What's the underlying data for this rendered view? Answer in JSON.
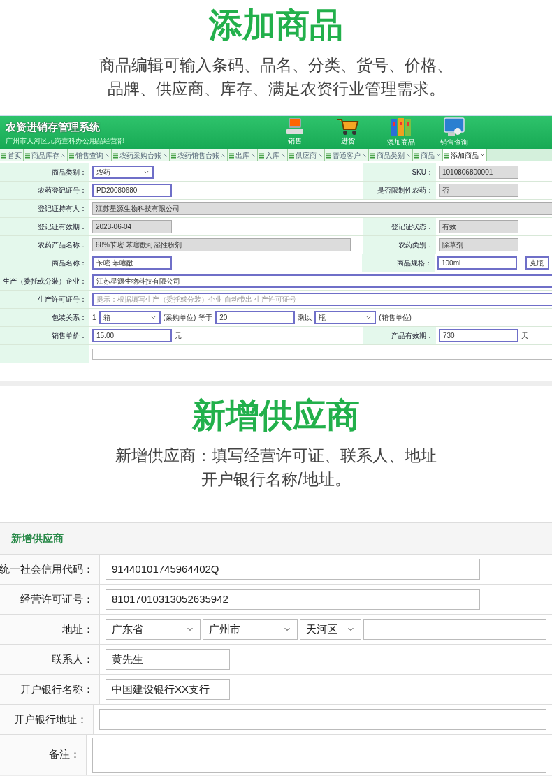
{
  "section_1": {
    "title": "添加商品",
    "description": [
      "商品编辑可输入条码、品名、分类、货号、价格、",
      "品牌、供应商、库存、满足农资行业管理需求。"
    ]
  },
  "app": {
    "title": "农资进销存管理系统",
    "subtitle": "广州市天河区元岗壹科办公用品经营部",
    "toolbar": [
      {
        "kind": "computer",
        "label": "销售"
      },
      {
        "kind": "cart",
        "label": "进货"
      },
      {
        "kind": "binders",
        "label": "添加商品"
      },
      {
        "kind": "monitor",
        "label": "销售查询"
      }
    ],
    "tabs": [
      {
        "label": "首页",
        "closable": false,
        "selected": false
      },
      {
        "label": "商品库存",
        "closable": true,
        "selected": false
      },
      {
        "label": "销售查询",
        "closable": true,
        "selected": false
      },
      {
        "label": "农药采购台账",
        "closable": true,
        "selected": false
      },
      {
        "label": "农药销售台账",
        "closable": true,
        "selected": false
      },
      {
        "label": "出库",
        "closable": true,
        "selected": false
      },
      {
        "label": "入库",
        "closable": true,
        "selected": false
      },
      {
        "label": "供应商",
        "closable": true,
        "selected": false
      },
      {
        "label": "普通客户",
        "closable": true,
        "selected": false
      },
      {
        "label": "商品类别",
        "closable": true,
        "selected": false
      },
      {
        "label": "商品",
        "closable": true,
        "selected": false
      },
      {
        "label": "添加商品",
        "closable": true,
        "selected": true
      }
    ],
    "form_rows": [
      {
        "groups": [
          {
            "label": "商品类别：",
            "fields": [
              {
                "kind": "select",
                "value": "农药"
              }
            ]
          },
          {
            "label": "SKU：",
            "fields": [
              {
                "kind": "readonly",
                "value": "1010806800001"
              }
            ]
          }
        ]
      },
      {
        "groups": [
          {
            "label": "农药登记证号：",
            "fields": [
              {
                "kind": "input",
                "value": "PD20080680"
              }
            ]
          },
          {
            "label": "是否限制性农药：",
            "fields": [
              {
                "kind": "readonly",
                "value": "否"
              }
            ]
          }
        ]
      },
      {
        "groups": [
          {
            "label": "登记证持有人：",
            "fields": [
              {
                "kind": "readonly_wide",
                "value": "江苏星源生物科技有限公司"
              }
            ]
          }
        ]
      },
      {
        "groups": [
          {
            "label": "登记证有效期：",
            "fields": [
              {
                "kind": "readonly",
                "value": "2023-06-04"
              }
            ]
          },
          {
            "label": "登记证状态：",
            "fields": [
              {
                "kind": "readonly",
                "value": "有效"
              }
            ]
          }
        ]
      },
      {
        "groups": [
          {
            "label": "农药产品名称：",
            "fields": [
              {
                "kind": "readonly_long",
                "value": "68%苄嘧 苯噻酰可湿性粉剂"
              }
            ]
          },
          {
            "label": "农药类别：",
            "fields": [
              {
                "kind": "readonly",
                "value": "除草剂"
              }
            ]
          }
        ]
      },
      {
        "groups": [
          {
            "label": "商品名称：",
            "fields": [
              {
                "kind": "input",
                "value": "苄嘧 苯噻酰"
              }
            ]
          },
          {
            "label": "商品规格：",
            "fields": [
              {
                "kind": "input",
                "value": "100ml"
              },
              {
                "kind": "input_short",
                "value": "克瓶"
              }
            ]
          }
        ]
      },
      {
        "groups": [
          {
            "label": "生产（委托或分装）企业：",
            "fields": [
              {
                "kind": "input_wide",
                "value": "江苏星源生物科技有限公司"
              }
            ]
          }
        ]
      },
      {
        "groups": [
          {
            "label": "生产许可证号：",
            "fields": [
              {
                "kind": "input_wide",
                "placeholder": "提示：根据填写生产（委托或分装）企业 自动带出 生产许可证号"
              }
            ]
          }
        ]
      },
      {
        "groups": [
          {
            "label": "包装关系：",
            "fields": [
              {
                "kind": "text",
                "value": "1"
              },
              {
                "kind": "select",
                "value": "箱"
              },
              {
                "kind": "text",
                "value": "(采购单位)"
              },
              {
                "kind": "text",
                "value": "等于"
              },
              {
                "kind": "input",
                "value": "20"
              },
              {
                "kind": "text",
                "value": "乘以"
              },
              {
                "kind": "select",
                "value": "瓶"
              },
              {
                "kind": "text",
                "value": "(销售单位)"
              }
            ]
          }
        ]
      },
      {
        "groups": [
          {
            "label": "销售单价：",
            "fields": [
              {
                "kind": "input",
                "value": "15.00"
              },
              {
                "kind": "text",
                "value": "元"
              }
            ]
          },
          {
            "label": "产品有效期：",
            "fields": [
              {
                "kind": "input",
                "value": "730"
              },
              {
                "kind": "text",
                "value": "天"
              }
            ]
          }
        ]
      },
      {
        "groups": [
          {
            "fields": [
              {
                "kind": "textarea"
              }
            ]
          }
        ]
      }
    ]
  },
  "section_2": {
    "title": "新增供应商",
    "description": [
      "新增供应商：填写经营许可证、联系人、地址",
      "开户银行名称/地址。"
    ]
  },
  "supplier_form": {
    "title": "新增供应商",
    "rows": [
      {
        "label": "统一社会信用代码：",
        "fields": [
          {
            "kind": "input",
            "value": "91440101745964402Q"
          }
        ]
      },
      {
        "label": "经营许可证号：",
        "fields": [
          {
            "kind": "input",
            "value": "81017010313052635942"
          }
        ]
      },
      {
        "label": "地址：",
        "fields": [
          {
            "kind": "select",
            "value": "广东省"
          },
          {
            "kind": "select",
            "value": "广州市"
          },
          {
            "kind": "select_small",
            "value": "天河区"
          },
          {
            "kind": "input_rest"
          }
        ]
      },
      {
        "label": "联系人：",
        "fields": [
          {
            "kind": "input_short",
            "value": "黄先生"
          }
        ]
      },
      {
        "label": "开户银行名称：",
        "fields": [
          {
            "kind": "input_short",
            "value": "中国建设银行XX支行"
          }
        ]
      },
      {
        "label": "开户银行地址：",
        "fields": [
          {
            "kind": "input_full"
          }
        ]
      },
      {
        "label": "备注：",
        "fields": [
          {
            "kind": "textarea"
          }
        ]
      }
    ]
  }
}
